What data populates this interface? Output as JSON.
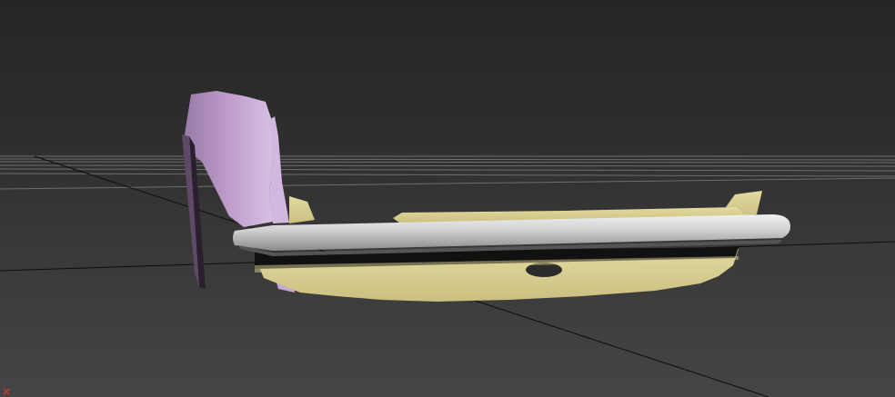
{
  "viewport": {
    "background_top": "#252525",
    "background_bottom": "#454545",
    "grid_color": "#6e6e6e",
    "model": {
      "bumper_color": "#cbcbcb",
      "panel_color": "#d9cf94",
      "fender_color": "#b997c4",
      "shadow_color": "#111111"
    },
    "axis_gizmo": {
      "x_color": "#c0392b"
    }
  }
}
